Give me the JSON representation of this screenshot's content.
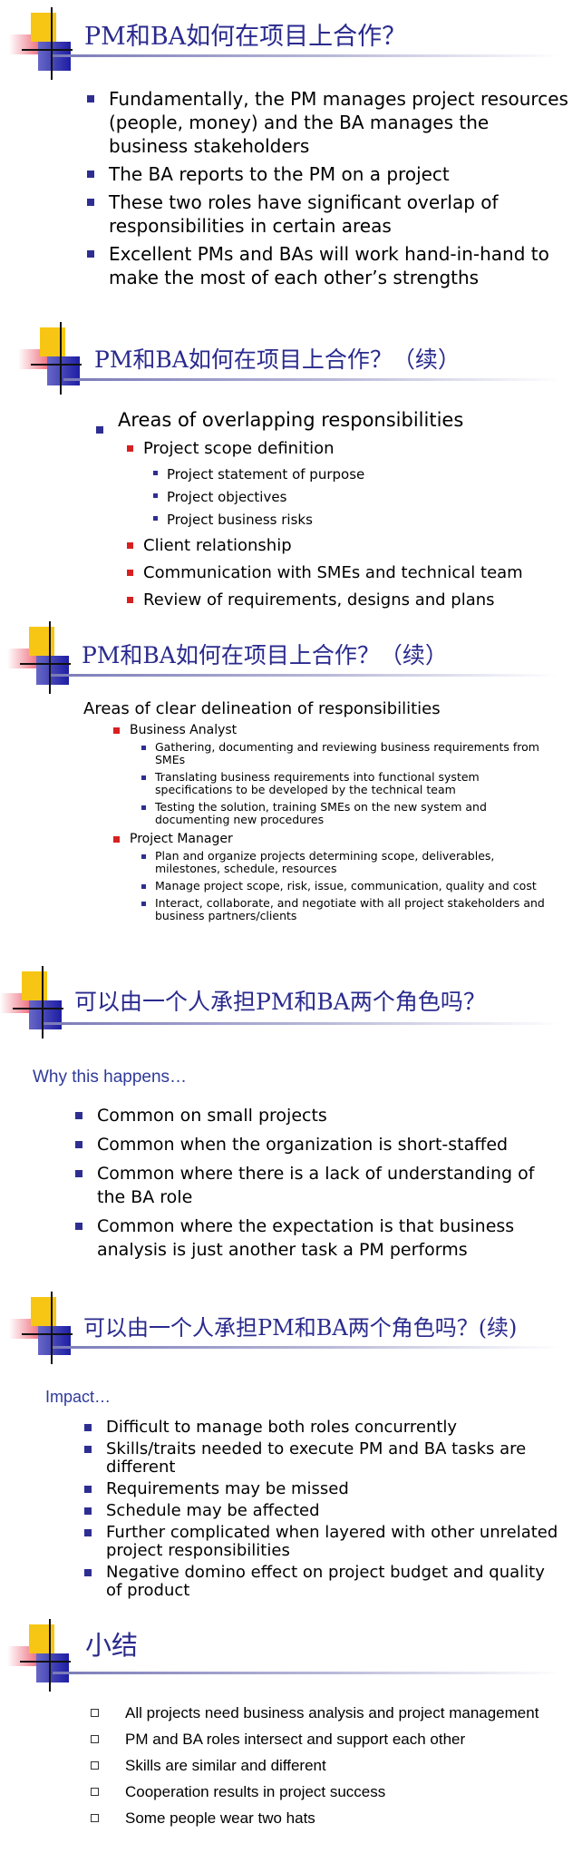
{
  "slides": [
    {
      "title": "PM和BA如何在项目上合作？",
      "bullets": [
        "Fundamentally, the PM manages project resources (people, money) and the BA manages the business stakeholders",
        "The BA reports to the PM on a project",
        "These two roles have significant overlap of responsibilities in certain areas",
        "Excellent PMs and BAs will work hand-in-hand to make the most of each other’s strengths"
      ]
    },
    {
      "title": "PM和BA如何在项目上合作？（续）",
      "heading": "Areas of overlapping responsibilities",
      "items": [
        {
          "label": "Project scope definition",
          "sub": [
            "Project statement of purpose",
            "Project objectives",
            "Project business risks"
          ]
        },
        {
          "label": "Client relationship",
          "sub": []
        },
        {
          "label": "Communication with SMEs and technical team",
          "sub": []
        },
        {
          "label": "Review of requirements, designs and plans",
          "sub": []
        }
      ]
    },
    {
      "title": "PM和BA如何在项目上合作？（续）",
      "heading": "Areas of clear delineation of responsibilities",
      "groups": [
        {
          "label": "Business Analyst",
          "sub": [
            "Gathering, documenting and reviewing business requirements from SMEs",
            "Translating business requirements into functional system specifications to be developed by the technical team",
            "Testing the solution, training SMEs on the new system and documenting new procedures"
          ]
        },
        {
          "label": "Project Manager",
          "sub": [
            "Plan and organize projects determining scope, deliverables, milestones, schedule, resources",
            "Manage project scope, risk, issue, communication, quality and cost",
            "Interact, collaborate, and negotiate with all project stakeholders and business partners/clients"
          ]
        }
      ]
    },
    {
      "title": "可以由一个人承担PM和BA两个角色吗？",
      "subheading": "Why this happens…",
      "bullets": [
        "Common on small projects",
        "Common when the organization is short-staffed",
        "Common where there is a lack of understanding of the BA role",
        "Common where the expectation is that business analysis is just another task a PM performs"
      ]
    },
    {
      "title": "可以由一个人承担PM和BA两个角色吗？(续)",
      "subheading": "Impact…",
      "bullets": [
        "Difficult to manage both roles concurrently",
        "Skills/traits needed to execute PM and BA tasks are different",
        "Requirements may be missed",
        "Schedule may be affected",
        "Further complicated when layered with other unrelated project responsibilities",
        "Negative domino effect on project budget and quality of product"
      ]
    },
    {
      "title": "小结",
      "bullets": [
        "All projects need business analysis and project management",
        "PM and BA roles intersect and support each other",
        "Skills are similar and different",
        "Cooperation results in project success",
        "Some people wear two hats"
      ]
    }
  ]
}
